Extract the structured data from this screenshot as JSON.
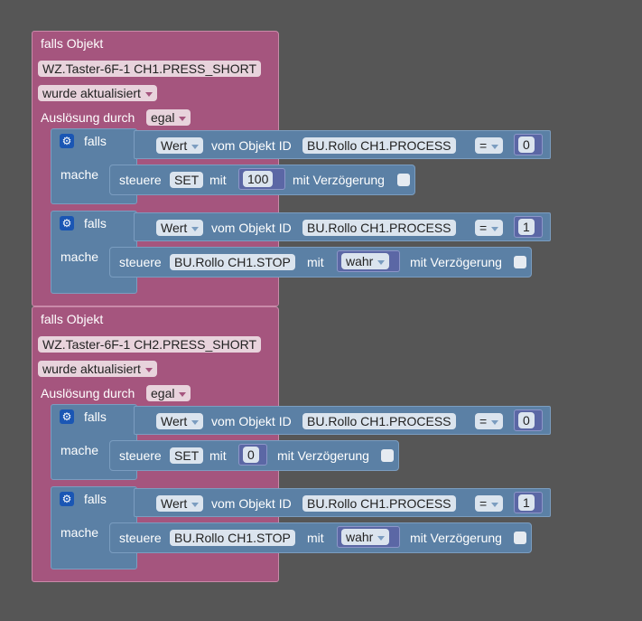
{
  "blocks": [
    {
      "header": "falls Objekt",
      "object_id": "WZ.Taster-6F-1 CH1.PRESS_SHORT",
      "event": "wurde aktualisiert",
      "trigger_label": "Auslösung durch",
      "trigger_value": "egal",
      "ifs": [
        {
          "if_label": "falls",
          "do_label": "mache",
          "cond": {
            "field": "Wert",
            "of_label": "vom Objekt ID",
            "object": "BU.Rollo CH1.PROCESS",
            "op": "=",
            "value": "0"
          },
          "action": {
            "verb": "steuere",
            "target": "SET",
            "with_label": "mit",
            "value": "100",
            "delay_label": "mit Verzögerung"
          }
        },
        {
          "if_label": "falls",
          "do_label": "mache",
          "cond": {
            "field": "Wert",
            "of_label": "vom Objekt ID",
            "object": "BU.Rollo CH1.PROCESS",
            "op": "=",
            "value": "1"
          },
          "action": {
            "verb": "steuere",
            "target": "BU.Rollo CH1.STOP",
            "with_label": "mit",
            "value": "wahr",
            "delay_label": "mit Verzögerung"
          }
        }
      ]
    },
    {
      "header": "falls Objekt",
      "object_id": "WZ.Taster-6F-1 CH2.PRESS_SHORT",
      "event": "wurde aktualisiert",
      "trigger_label": "Auslösung durch",
      "trigger_value": "egal",
      "ifs": [
        {
          "if_label": "falls",
          "do_label": "mache",
          "cond": {
            "field": "Wert",
            "of_label": "vom Objekt ID",
            "object": "BU.Rollo CH1.PROCESS",
            "op": "=",
            "value": "0"
          },
          "action": {
            "verb": "steuere",
            "target": "SET",
            "with_label": "mit",
            "value": "0",
            "delay_label": "mit Verzögerung"
          }
        },
        {
          "if_label": "falls",
          "do_label": "mache",
          "cond": {
            "field": "Wert",
            "of_label": "vom Objekt ID",
            "object": "BU.Rollo CH1.PROCESS",
            "op": "=",
            "value": "1"
          },
          "action": {
            "verb": "steuere",
            "target": "BU.Rollo CH1.STOP",
            "with_label": "mit",
            "value": "wahr",
            "delay_label": "mit Verzögerung"
          }
        }
      ]
    }
  ],
  "colors": {
    "background": "#565656",
    "event_block": "#a5557e",
    "logic_block": "#5b80a5",
    "number_block": "#5b67a5",
    "gear_icon": "#1a56b4"
  },
  "icons": [
    "gear-icon",
    "dropdown-arrow-icon",
    "checkbox-icon"
  ]
}
